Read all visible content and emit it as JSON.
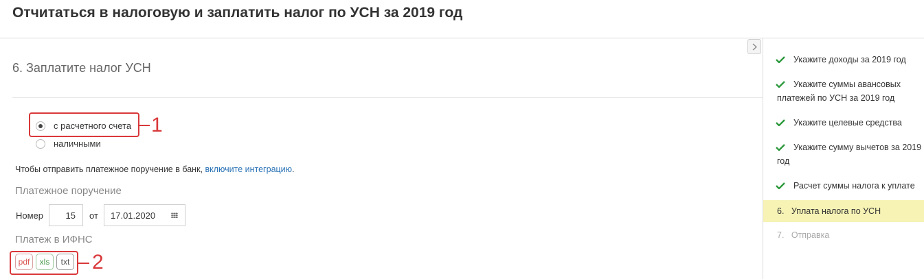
{
  "page_title": "Отчитаться в налоговую и заплатить налог по УСН за 2019 год",
  "step_heading": "6. Заплатите налог УСН",
  "payment_method": {
    "options": [
      "с расчетного счета",
      "наличными"
    ],
    "selected": "с расчетного счета"
  },
  "integration": {
    "text": "Чтобы отправить платежное поручение в банк, ",
    "link": "включите интеграцию",
    "suffix": "."
  },
  "payment_order": {
    "label": "Платежное поручение",
    "number_label": "Номер",
    "number_value": "15",
    "date_label": "от",
    "date_value": "17.01.2020"
  },
  "ifns_payment": {
    "label": "Платеж в ИФНС",
    "formats": [
      "pdf",
      "xls",
      "txt"
    ]
  },
  "callouts": [
    "1",
    "2"
  ],
  "sidebar": {
    "steps": [
      {
        "label": "Укажите доходы за 2019 год",
        "status": "done"
      },
      {
        "label": "Укажите суммы авансовых платежей по УСН за 2019 год",
        "status": "done"
      },
      {
        "label": "Укажите целевые средства",
        "status": "done"
      },
      {
        "label": "Укажите сумму вычетов за 2019 год",
        "status": "done"
      },
      {
        "label": "Расчет суммы налога к уплате",
        "status": "done"
      },
      {
        "label": "6.   Уплата налога по УСН",
        "status": "active"
      },
      {
        "label": "7.   Отправка",
        "status": "pending"
      }
    ]
  },
  "colors": {
    "accent_red": "#d9383a",
    "check_green": "#2e9a3e",
    "link_blue": "#2a72b5",
    "active_step_bg": "#f6f3b5"
  }
}
